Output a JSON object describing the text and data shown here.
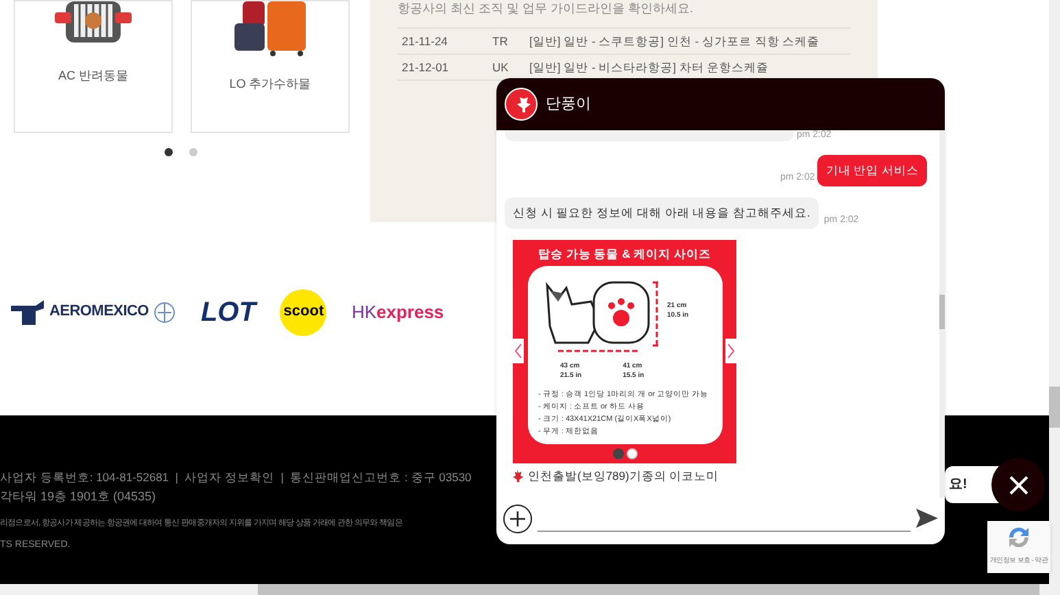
{
  "cards": [
    {
      "label": "AC 반려동물",
      "kind": "pet"
    },
    {
      "label": "LO 추가수하물",
      "kind": "luggage"
    }
  ],
  "carousel_dots": [
    {
      "selected": true
    },
    {
      "selected": false
    }
  ],
  "notice": {
    "intro": "항공사의 최신 조직 및 업무 가이드라인을 확인하세요.",
    "rows": [
      {
        "date": "21-11-24",
        "code": "TR",
        "title": "[일반] 일반 - 스쿠트항공] 인천 - 싱가포르 직항 스케줄"
      },
      {
        "date": "21-12-01",
        "code": "UK",
        "title": "[일반] 일반 - 비스타라항공] 차터 운항스케쥴"
      }
    ]
  },
  "airline_logos": [
    {
      "kind": "aeromexico",
      "text": "AEROMEXICO"
    },
    {
      "kind": "lot",
      "text": "LOT"
    },
    {
      "kind": "scoot",
      "text": "scoot"
    },
    {
      "kind": "hk",
      "text": "HK",
      "text2": "express"
    }
  ],
  "footer": {
    "lines": [
      "사업자 등록번호: 104-81-52681  |  사업자 정보확인  |  통신판매업신고번호 : 중구 03530",
      "각타워 19층 1901호 (04535)",
      "리점으로서, 항공사가 제공하는 항공권에 대하여 통신 판매중개자의 지위를 가지며 해당 상품 거래에 관한 의무와 책임은",
      "TS RESERVED."
    ]
  },
  "chat": {
    "title": "단풍이",
    "messages": [
      {
        "kind": "bot-partial",
        "time": "pm 2:02"
      },
      {
        "kind": "user",
        "text": "기내 반입 서비스",
        "time": "pm 2:02"
      },
      {
        "kind": "bot",
        "text": "신청 시 필요한 정보에 대해 아래 내용을 참고해주세요.",
        "time": "pm 2:02"
      }
    ],
    "card": {
      "title": "탑승 가능 동물 & 케이지 사이즈",
      "height": "21 cm",
      "height_in": "10.5 in",
      "length": "43 cm",
      "length_in": "21.5 in",
      "width": "41 cm",
      "width_in": "15.5 in",
      "rules": [
        "- 규정 : 승객 1인당 1마리의 개 or 고양이만 가능",
        "- 케이지 : 소프트 or 하드 사용",
        "- 크기 : 43X41X21CM (길이X폭X넓이)",
        "- 무게 : 제한없음"
      ],
      "dots": [
        {
          "selected": true
        },
        {
          "selected": false
        }
      ]
    },
    "note": "인천출발(보잉789)기종의 이코노미"
  },
  "side_bubble": "요!",
  "recaptcha": "개인정보 보호 - 약관"
}
